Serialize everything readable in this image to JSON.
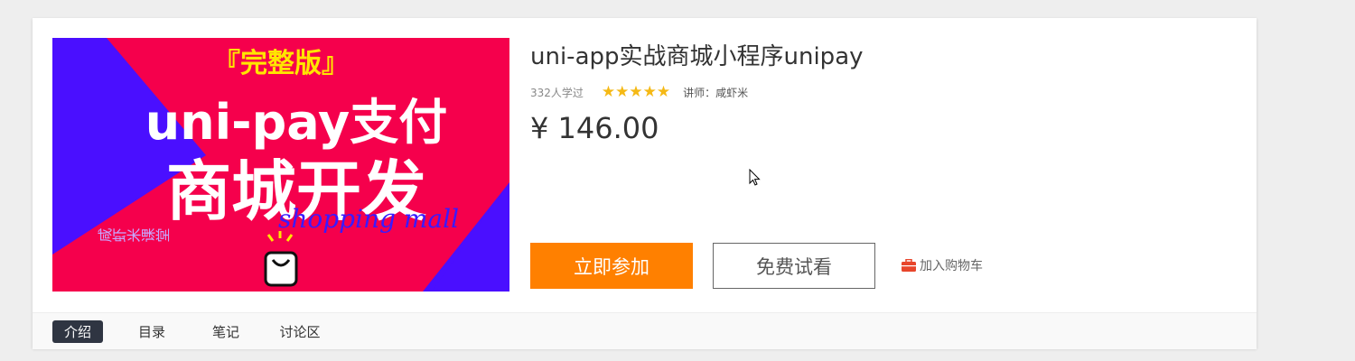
{
  "course": {
    "title": "uni-app实战商城小程序unipay",
    "learners": "332人学过",
    "rating": 5,
    "teacher": "讲师：咸虾米",
    "price": "¥ 146.00"
  },
  "cover": {
    "edition": "『完整版』",
    "line1": "uni-pay支付",
    "line2": "商城开发",
    "script": "shopping mall",
    "brand": "咸虾米课堂"
  },
  "actions": {
    "join_label": "立即参加",
    "free_label": "免费试看",
    "cart_label": "加入购物车"
  },
  "tabs": [
    {
      "label": "介绍",
      "active": true
    },
    {
      "label": "目录",
      "active": false
    },
    {
      "label": "笔记",
      "active": false
    },
    {
      "label": "讨论区",
      "active": false
    }
  ],
  "colors": {
    "accent": "#ff8000",
    "star": "#f5b915",
    "tab_active_bg": "#2f3542",
    "cover_red": "#f5004c",
    "cover_purple": "#4a0fff",
    "cover_yellow": "#ffe500"
  }
}
